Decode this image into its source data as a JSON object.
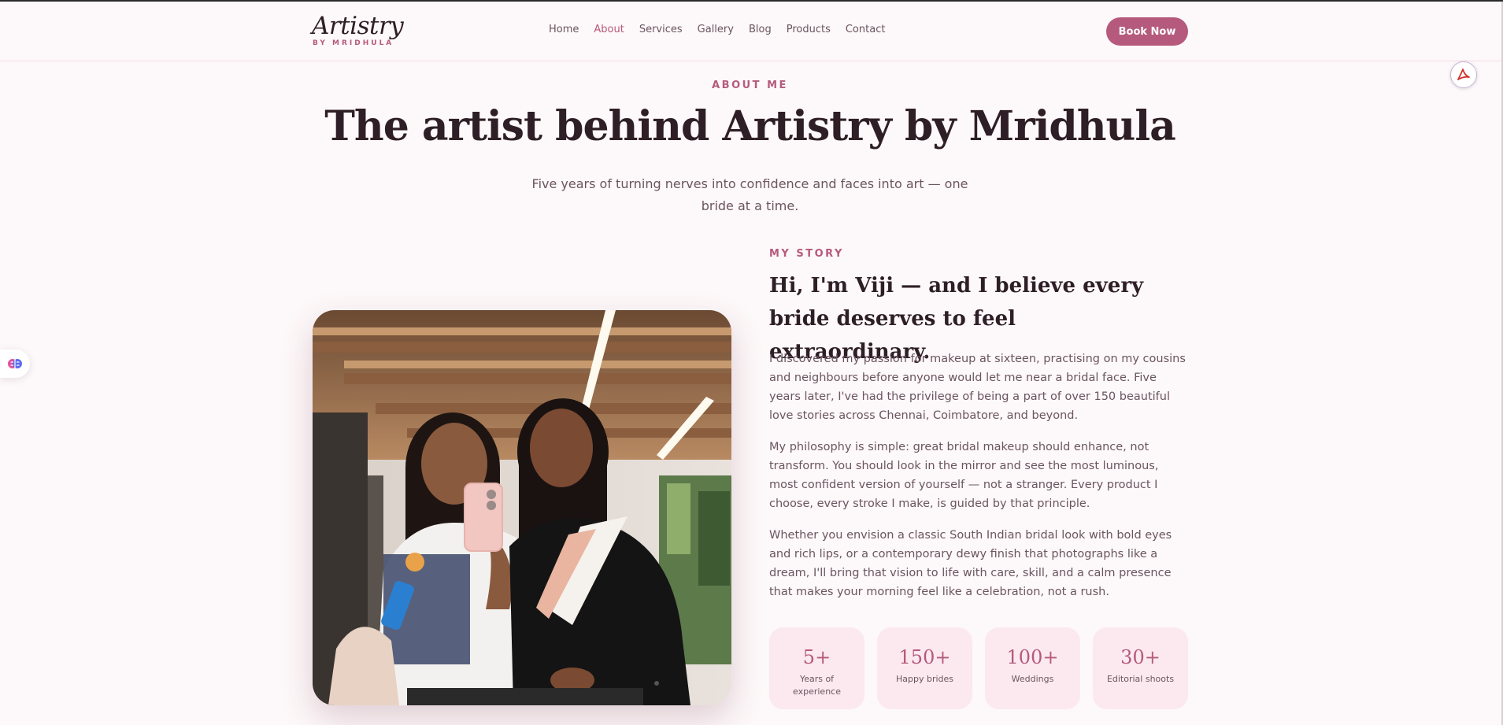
{
  "header": {
    "logo_main": "Artistry",
    "logo_sub": "BY MRIDHULA",
    "nav": [
      {
        "label": "Home",
        "active": false
      },
      {
        "label": "About",
        "active": true
      },
      {
        "label": "Services",
        "active": false
      },
      {
        "label": "Gallery",
        "active": false
      },
      {
        "label": "Blog",
        "active": false
      },
      {
        "label": "Products",
        "active": false
      },
      {
        "label": "Contact",
        "active": false
      }
    ],
    "cta_label": "Book Now"
  },
  "hero": {
    "eyebrow": "ABOUT ME",
    "title": "The artist behind Artistry by Mridhula",
    "subtitle": "Five years of turning nerves into confidence and faces into art — one bride at a time."
  },
  "story": {
    "eyebrow": "MY STORY",
    "title": "Hi, I'm Viji — and I believe every bride deserves to feel extraordinary.",
    "paragraphs": [
      "I discovered my passion for makeup at sixteen, practising on my cousins and neighbours before anyone would let me near a bridal face. Five years later, I've had the privilege of being a part of over 150 beautiful love stories across Chennai, Coimbatore, and beyond.",
      "My philosophy is simple: great bridal makeup should enhance, not transform. You should look in the mirror and see the most luminous, most confident version of yourself — not a stranger. Every product I choose, every stroke I make, is guided by that principle.",
      "Whether you envision a classic South Indian bridal look with bold eyes and rich lips, or a contemporary dewy finish that photographs like a dream, I'll bring that vision to life with care, skill, and a calm presence that makes your morning feel like a celebration, not a rush."
    ]
  },
  "stats": [
    {
      "value": "5+",
      "label": "Years of experience"
    },
    {
      "value": "150+",
      "label": "Happy brides"
    },
    {
      "value": "100+",
      "label": "Weddings"
    },
    {
      "value": "30+",
      "label": "Editorial shoots"
    }
  ],
  "icons": {
    "pdf": "adobe-pdf-icon",
    "side": "brain-extension-icon"
  },
  "colors": {
    "accent": "#b55a7c",
    "background": "#fdf8f9",
    "stat_card": "#fbe9ef",
    "heading": "#2e1f26"
  }
}
